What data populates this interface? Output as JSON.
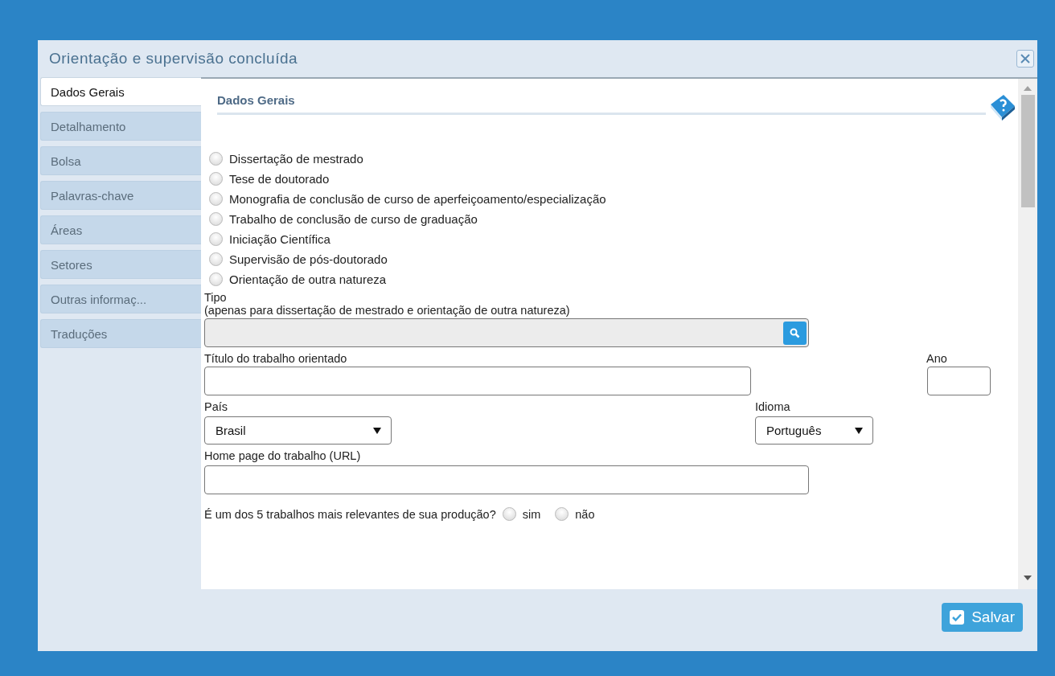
{
  "dialog": {
    "title": "Orientação e supervisão concluída"
  },
  "tabs": [
    {
      "label": "Dados Gerais",
      "selected": true
    },
    {
      "label": "Detalhamento",
      "selected": false
    },
    {
      "label": "Bolsa",
      "selected": false
    },
    {
      "label": "Palavras-chave",
      "selected": false
    },
    {
      "label": "Áreas",
      "selected": false
    },
    {
      "label": "Setores",
      "selected": false
    },
    {
      "label": "Outras informaç...",
      "selected": false
    },
    {
      "label": "Traduções",
      "selected": false
    }
  ],
  "section_title": "Dados Gerais",
  "nature_options": [
    {
      "label": "Dissertação de mestrado",
      "selected": false
    },
    {
      "label": "Tese de doutorado",
      "selected": false
    },
    {
      "label": "Monografia de conclusão de curso de aperfeiçoamento/especialização",
      "selected": false
    },
    {
      "label": "Trabalho de conclusão de curso de graduação",
      "selected": false
    },
    {
      "label": "Iniciação Científica",
      "selected": false
    },
    {
      "label": "Supervisão de pós-doutorado",
      "selected": false
    },
    {
      "label": "Orientação de outra natureza",
      "selected": false
    }
  ],
  "tipo": {
    "label": "Tipo",
    "hint": "(apenas para dissertação de mestrado e orientação de outra natureza)"
  },
  "titulo": {
    "label": "Título do trabalho orientado"
  },
  "ano": {
    "label": "Ano"
  },
  "pais": {
    "label": "País",
    "value": "Brasil"
  },
  "idioma": {
    "label": "Idioma",
    "value": "Português"
  },
  "homepage": {
    "label": "Home page do trabalho (URL)"
  },
  "relevant": {
    "question": "É um dos 5 trabalhos mais relevantes de sua produção?",
    "options": [
      {
        "label": "sim",
        "selected": false
      },
      {
        "label": "não",
        "selected": false
      }
    ]
  },
  "save_button": "Salvar"
}
